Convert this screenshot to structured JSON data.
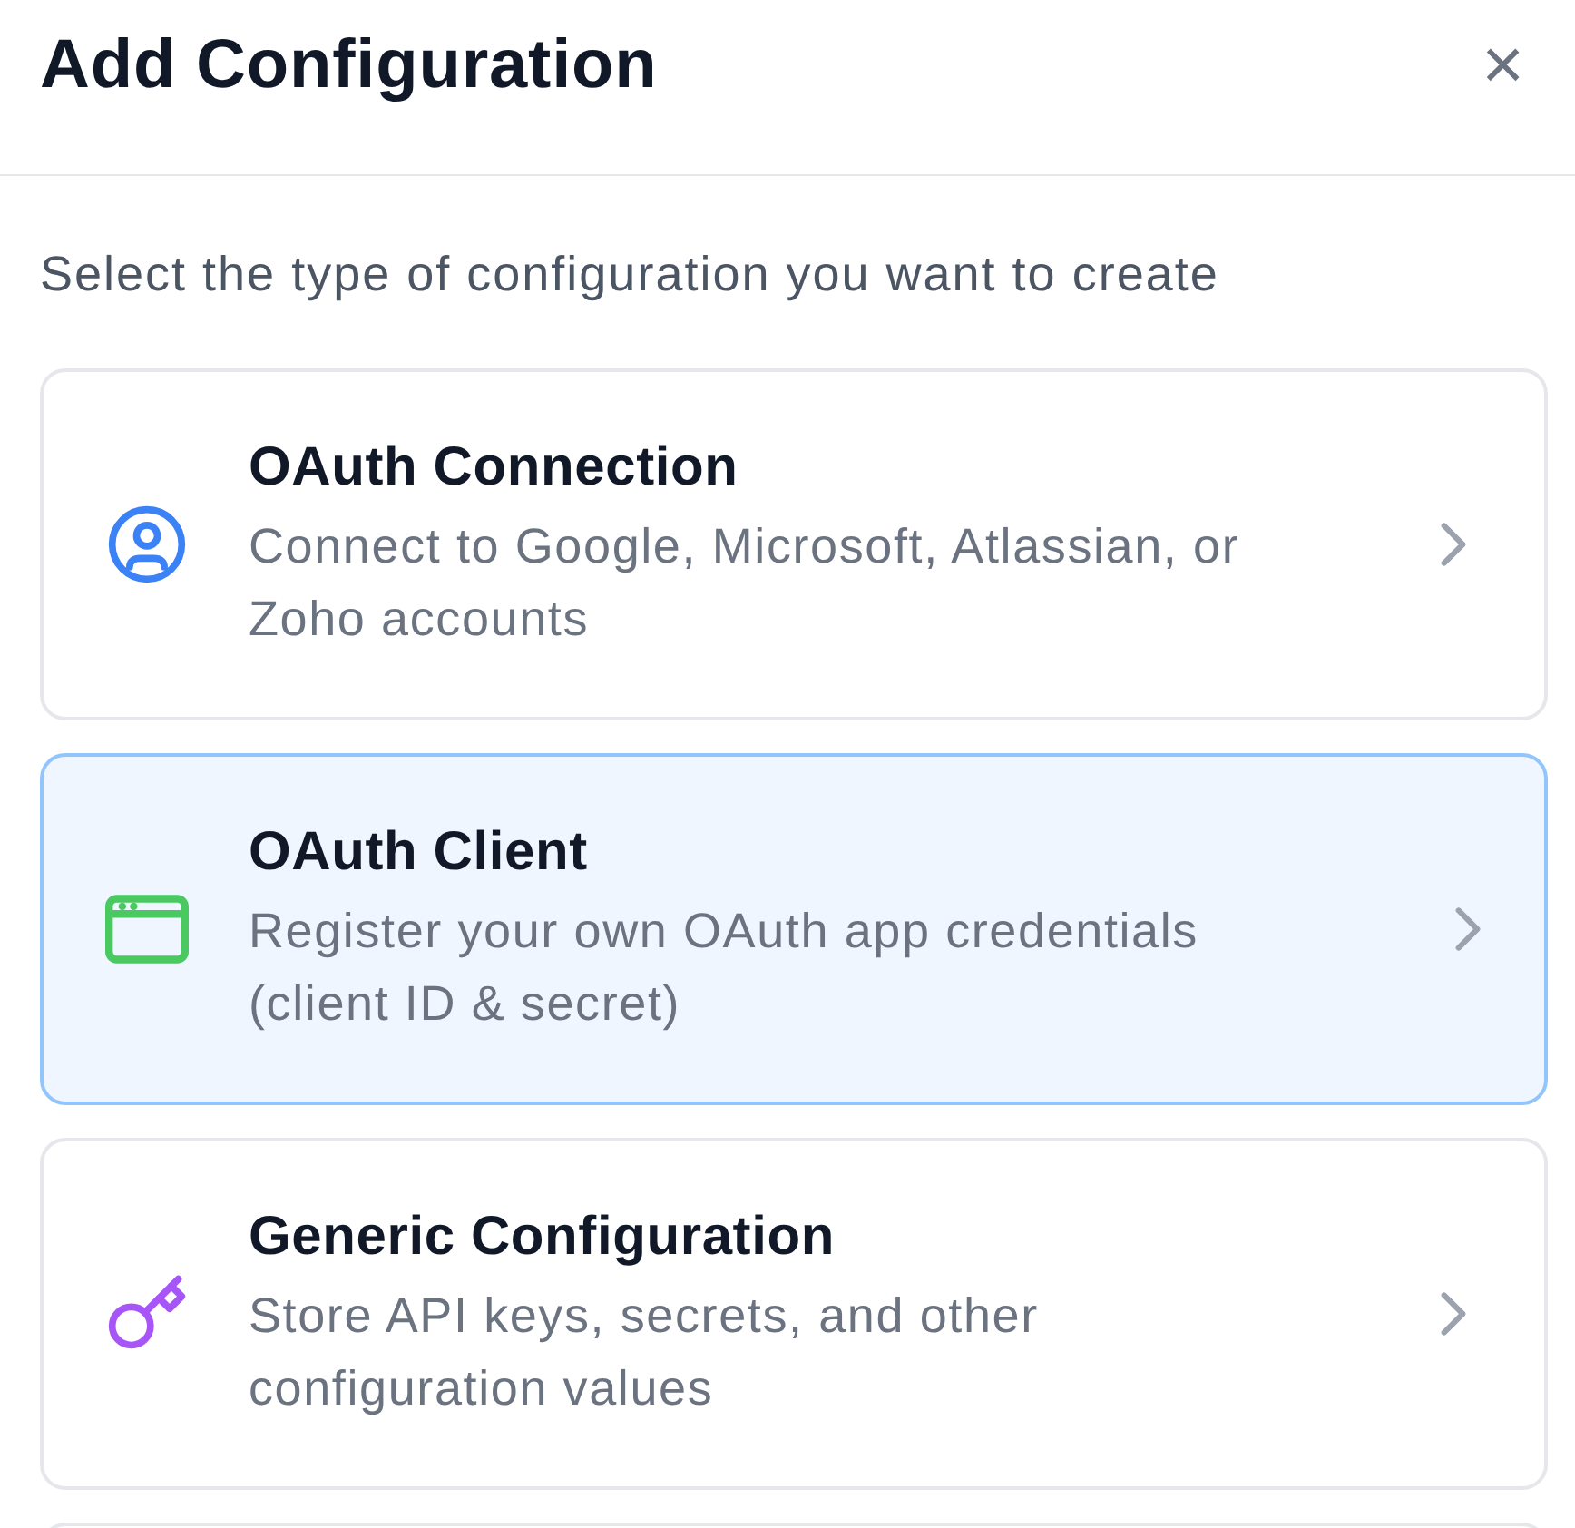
{
  "dialog": {
    "title": "Add Configuration",
    "close_icon": "×"
  },
  "prompt": "Select the type of configuration you want to create",
  "options": [
    {
      "kind": "oauth_connection",
      "title": "OAuth Connection",
      "description": "Connect to Google, Microsoft, Atlassian, or Zoho accounts",
      "selected": false
    },
    {
      "kind": "oauth_client",
      "title": "OAuth Client",
      "description": "Register your own OAuth app credentials (client ID & secret)",
      "selected": true
    },
    {
      "kind": "generic",
      "title": "Generic Configuration",
      "description": "Store API keys, secrets, and other configuration values",
      "selected": false
    }
  ],
  "list_continues": true
}
